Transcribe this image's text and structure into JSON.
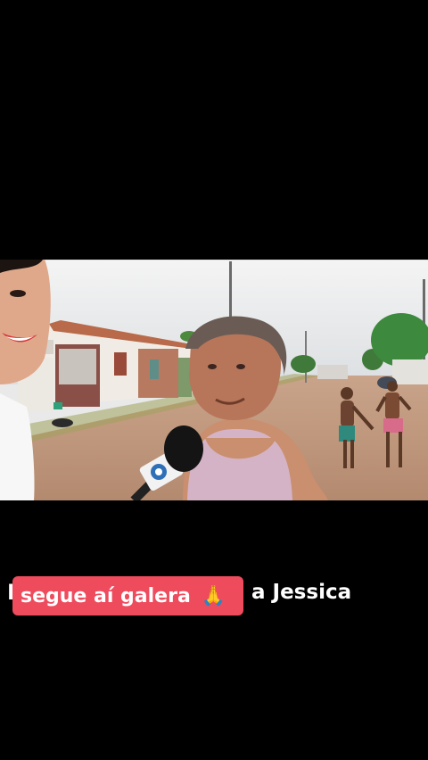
{
  "video": {
    "description_icon": "tv-microphone-icon"
  },
  "caption": {
    "start_glyph": "I",
    "end_text": "a Jessica"
  },
  "sticker": {
    "text": "segue aí galera",
    "emoji": "🙏",
    "color": "#ee4b5d"
  }
}
